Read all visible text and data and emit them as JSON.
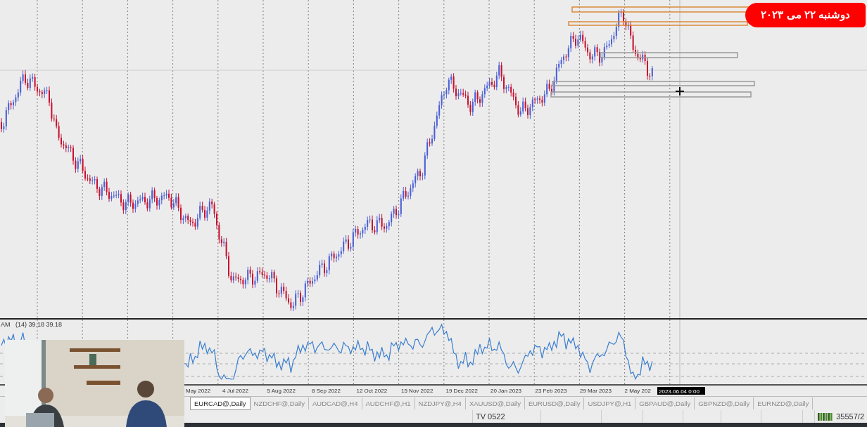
{
  "badge": {
    "text": "دوشنبه ۲۲ می ۲۰۲۳"
  },
  "chart": {
    "indicator_prefix": "AM",
    "indicator_values": "(14) 39.18 39.18",
    "time_labels": [
      "May 2022",
      "4 Jul 2022",
      "5 Aug 2022",
      "8 Sep 2022",
      "12 Oct 2022",
      "15 Nov 2022",
      "19 Dec 2022",
      "20 Jan 2023",
      "23 Feb 2023",
      "29 Mar 2023",
      "2 May 202"
    ],
    "cursor_time": "2023.06.04 0:00"
  },
  "tabs": [
    {
      "label": "EURCAD@,Daily",
      "selected": true
    },
    {
      "label": "NZDCHF@,Daily",
      "selected": false
    },
    {
      "label": "AUDCAD@,H4",
      "selected": false
    },
    {
      "label": "AUDCHF@,H1",
      "selected": false
    },
    {
      "label": "NZDJPY@,H4",
      "selected": false
    },
    {
      "label": "XAUUSD@,Daily",
      "selected": false
    },
    {
      "label": "EURUSD@,Daily",
      "selected": false
    },
    {
      "label": "USDJPY@,H1",
      "selected": false
    },
    {
      "label": "GBPAUD@,Daily",
      "selected": false
    },
    {
      "label": "GBPNZD@,Daily",
      "selected": false
    },
    {
      "label": "EURNZD@,Daily",
      "selected": false
    }
  ],
  "status_bar": {
    "profile": "TV 0522",
    "traffic": "35557/2"
  }
}
